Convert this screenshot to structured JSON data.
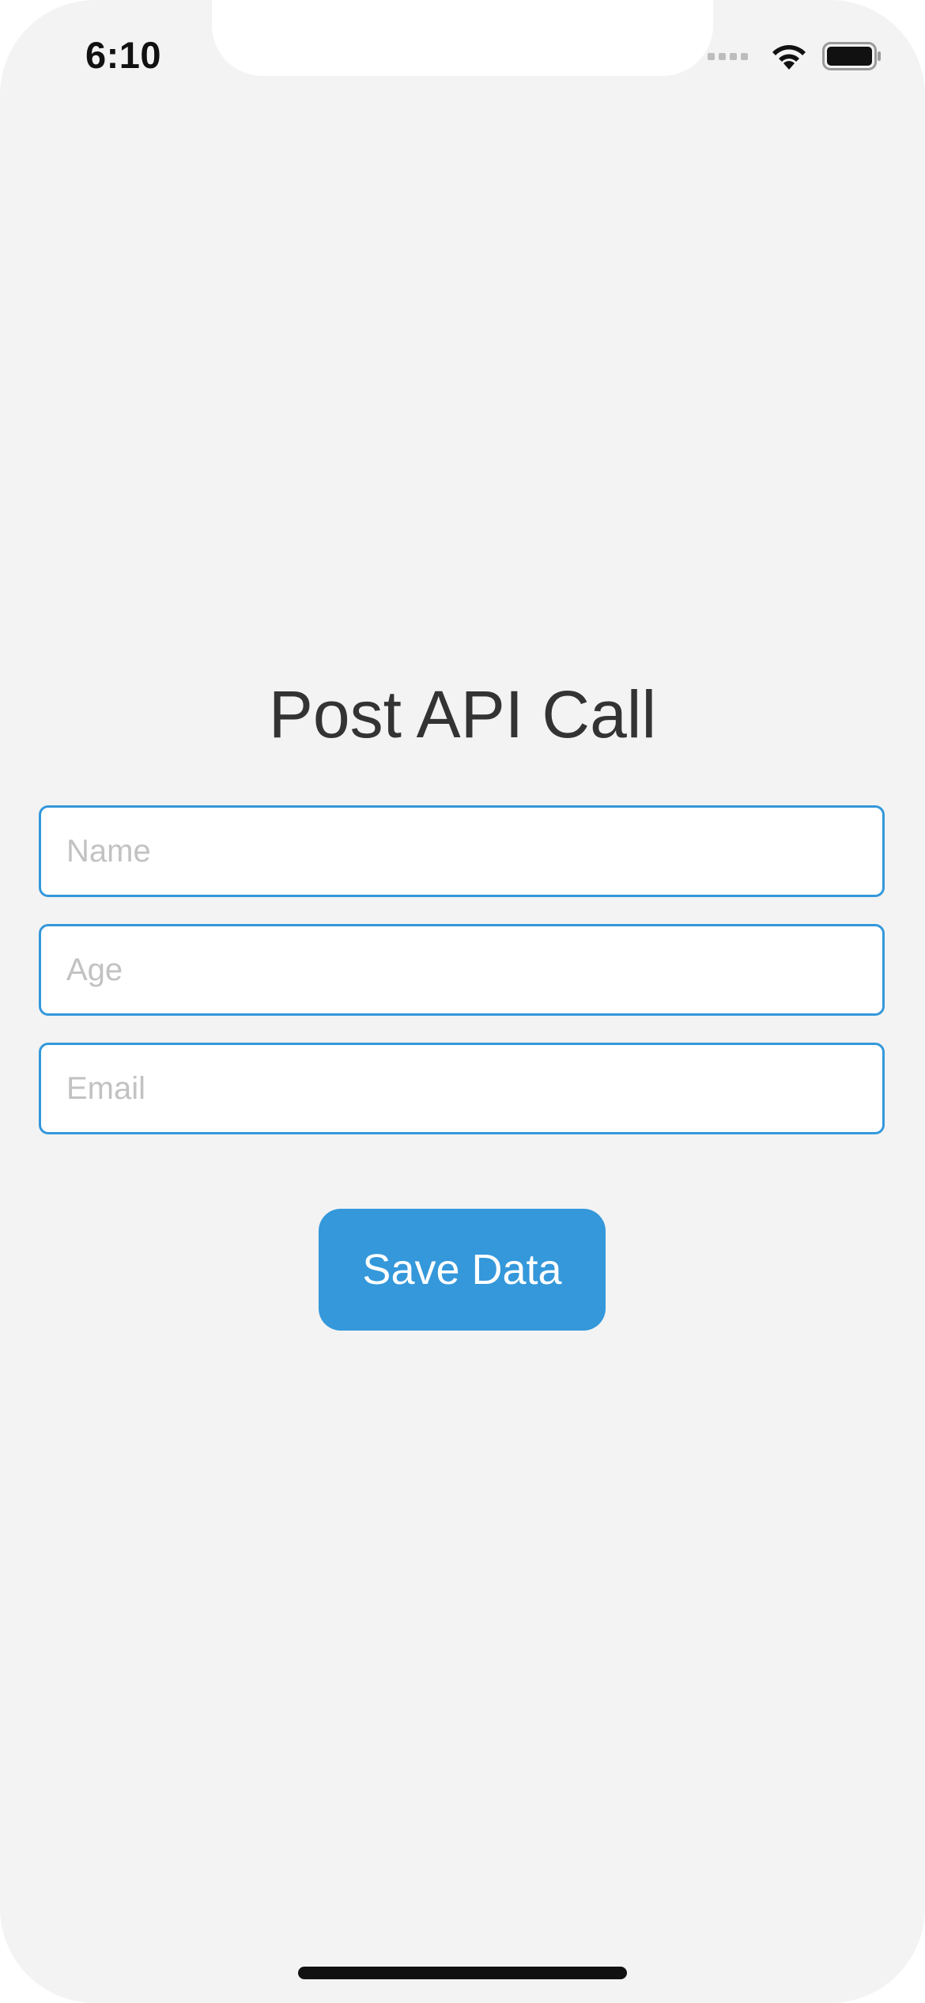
{
  "status_bar": {
    "time": "6:10",
    "icons": [
      "cellular-signal-icon",
      "wifi-icon",
      "battery-icon"
    ]
  },
  "main": {
    "title": "Post API Call",
    "fields": {
      "name": {
        "value": "",
        "placeholder": "Name"
      },
      "age": {
        "value": "",
        "placeholder": "Age"
      },
      "email": {
        "value": "",
        "placeholder": "Email"
      }
    },
    "save_button_label": "Save Data"
  },
  "colors": {
    "accent": "#3498db",
    "background": "#f3f3f3",
    "title_text": "#333333",
    "placeholder_text": "#c2c2c2"
  }
}
